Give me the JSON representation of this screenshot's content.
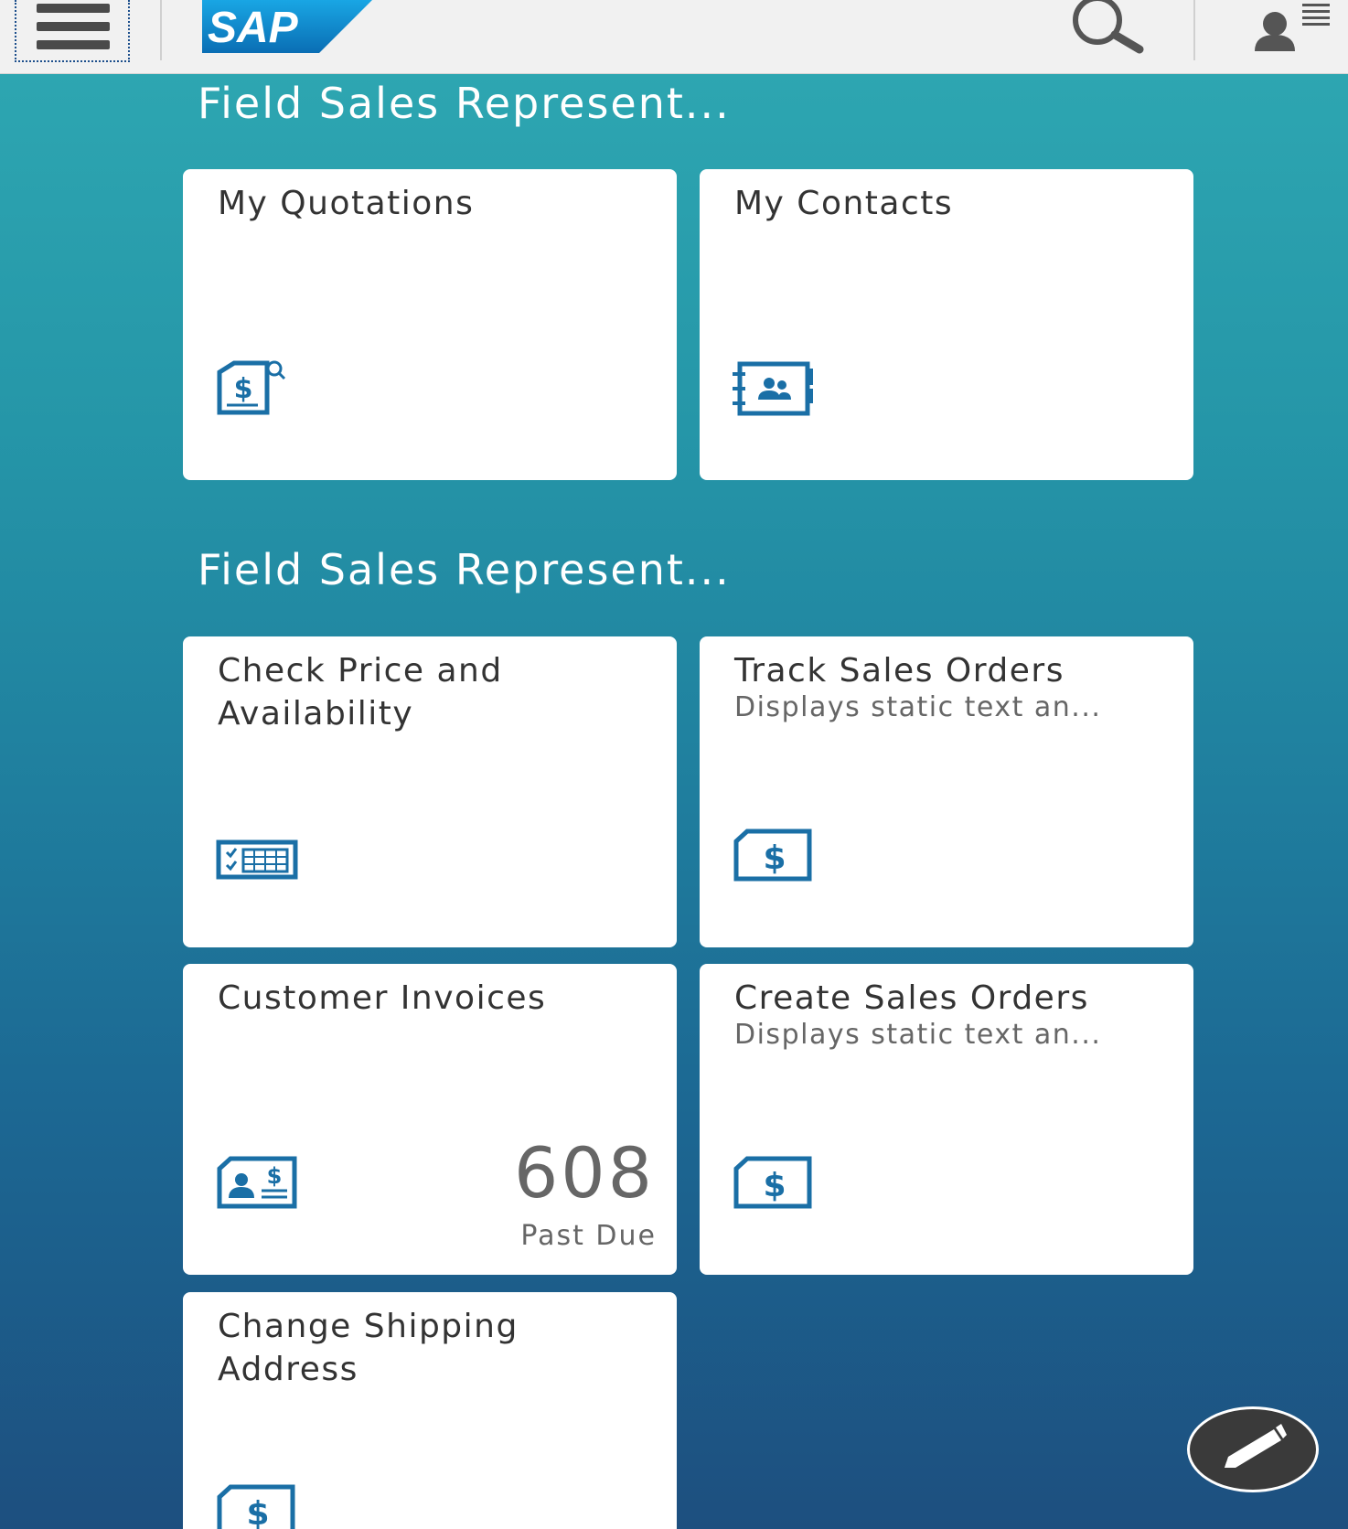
{
  "header": {
    "logo_text": "SAP",
    "menu_icon": "hamburger-menu-icon",
    "search_icon": "search-icon",
    "user_icon": "user-menu-icon"
  },
  "groups": [
    {
      "title": "Field Sales Represent...",
      "tiles": [
        {
          "title": "My Quotations",
          "icon": "quotation-dollar-search-icon"
        },
        {
          "title": "My Contacts",
          "icon": "address-book-icon"
        }
      ]
    },
    {
      "title": "Field Sales Represent...",
      "tiles": [
        {
          "title": "Check Price and Availability",
          "icon": "price-availability-calendar-icon"
        },
        {
          "title": "Track Sales Orders",
          "subtitle": "Displays static text an...",
          "icon": "sales-order-dollar-icon"
        },
        {
          "title": "Customer Invoices",
          "icon": "customer-invoice-icon",
          "number": "608",
          "footer": "Past Due"
        },
        {
          "title": "Create Sales Orders",
          "subtitle": "Displays static text an...",
          "icon": "sales-order-dollar-icon"
        },
        {
          "title": "Change Shipping Address",
          "icon": "sales-order-dollar-icon"
        }
      ]
    }
  ],
  "edit_button": {
    "icon": "pencil-icon"
  },
  "colors": {
    "brand_blue": "#0a6eb4",
    "header_bg": "#f1f1f1",
    "gradient_top": "#2fa9b3",
    "gradient_bottom": "#1d4f7f",
    "icon_blue": "#1a6fa6"
  }
}
